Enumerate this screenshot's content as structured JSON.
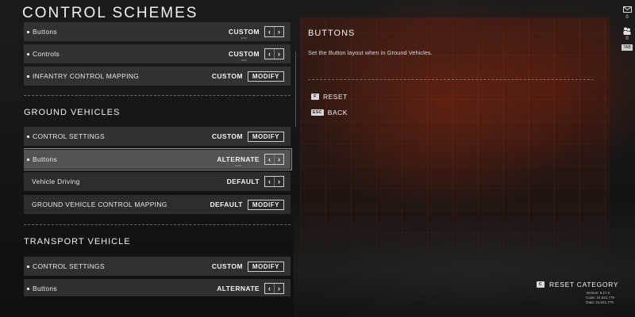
{
  "page_title": "CONTROL SCHEMES",
  "sections": [
    {
      "title": "",
      "rows": [
        {
          "label": "Buttons",
          "bullet": true,
          "value": "CUSTOM",
          "dots": "••••",
          "control": "arrows"
        },
        {
          "label": "Controls",
          "bullet": true,
          "value": "CUSTOM",
          "dots": "••••",
          "control": "arrows"
        },
        {
          "label": "INFANTRY CONTROL MAPPING",
          "bullet": true,
          "value": "CUSTOM",
          "control": "modify"
        }
      ]
    },
    {
      "title": "GROUND VEHICLES",
      "rows": [
        {
          "label": "CONTROL SETTINGS",
          "bullet": true,
          "value": "CUSTOM",
          "control": "modify"
        },
        {
          "label": "Buttons",
          "bullet": true,
          "value": "ALTERNATE",
          "dots": "••••",
          "control": "arrows",
          "selected": true
        },
        {
          "label": "Vehicle Driving",
          "bullet": false,
          "value": "DEFAULT",
          "control": "arrows"
        },
        {
          "label": "GROUND VEHICLE CONTROL MAPPING",
          "bullet": false,
          "value": "DEFAULT",
          "control": "modify"
        }
      ]
    },
    {
      "title": "TRANSPORT VEHICLE",
      "rows": [
        {
          "label": "CONTROL SETTINGS",
          "bullet": true,
          "value": "CUSTOM",
          "control": "modify"
        },
        {
          "label": "Buttons",
          "bullet": true,
          "value": "ALTERNATE",
          "control": "arrows"
        }
      ]
    }
  ],
  "controls": {
    "modify_label": "MODIFY",
    "left_arrow": "‹",
    "right_arrow": "›"
  },
  "detail": {
    "title": "BUTTONS",
    "description": "Set the Button layout when in Ground Vehicles."
  },
  "actions": [
    {
      "key": "F",
      "label": "RESET"
    },
    {
      "key": "ESC",
      "label": "BACK"
    }
  ],
  "rail": {
    "mail_count": "0",
    "party_count": "0",
    "tab_key": "TAB",
    "icons": [
      "mail-icon",
      "party-icon"
    ]
  },
  "reset_category": {
    "key": "C",
    "label": "RESET CATEGORY"
  },
  "version_info": {
    "version": "Version: 8.17.0",
    "code": "Code: 24,641,779",
    "data": "Data: 24,641,779"
  }
}
